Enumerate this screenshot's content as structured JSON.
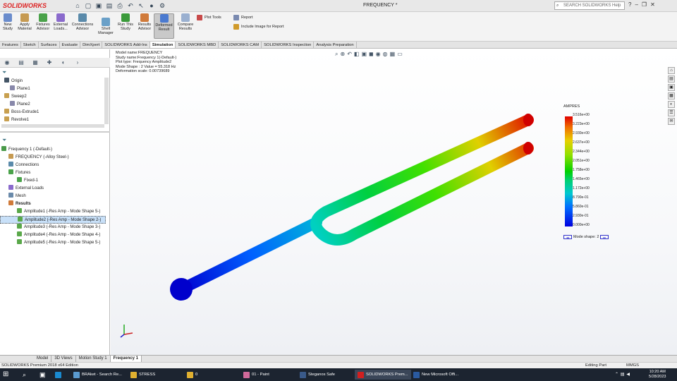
{
  "app": {
    "logo": "SOLIDWORKS",
    "window_title": "FREQUENCY *",
    "help_placeholder": "SEARCH SOLIDWORKS Help"
  },
  "ribbon": {
    "buttons": [
      {
        "label": "New\nStudy"
      },
      {
        "label": "Apply\nMaterial"
      },
      {
        "label": "Fixtures\nAdvisor"
      },
      {
        "label": "External\nLoads..."
      },
      {
        "label": "Connections\nAdvisor"
      },
      {
        "label": "Shell\nManager"
      },
      {
        "label": "Run This\nStudy"
      },
      {
        "label": "Results\nAdvisor"
      },
      {
        "label": "Deformed\nResult"
      },
      {
        "label": "Compare\nResults"
      }
    ],
    "plot_tools": "Plot Tools",
    "report": "Report",
    "include_image": "Include Image for Report"
  },
  "tabs": [
    "Features",
    "Sketch",
    "Surfaces",
    "Evaluate",
    "DimXpert",
    "SOLIDWORKS Add-Ins",
    "Simulation",
    "SOLIDWORKS MBD",
    "SOLIDWORKS CAM",
    "SOLIDWORKS Inspection",
    "Analysis Preparation"
  ],
  "feature_tree": [
    "Origin",
    "Plane1",
    "Sweep2",
    "Plane2",
    "Boss-Extrude1",
    "Revolve1"
  ],
  "sim_tree": {
    "study": "Frequency 1 (-Default-)",
    "items": [
      "FREQUENCY (-Alloy Steel-)",
      "Connections",
      "Fixtures",
      "Fixed-1",
      "External Loads",
      "Mesh",
      "Results"
    ],
    "results": [
      "Amplitude1 (-Res Amp - Mode Shape 5-)",
      "Amplitude2 (-Res Amp - Mode Shape 2-)",
      "Amplitude3 (-Res Amp - Mode Shape 3-)",
      "Amplitude4 (-Res Amp - Mode Shape 4-)",
      "Amplitude5 (-Res Amp - Mode Shape 5-)"
    ]
  },
  "plot_info": {
    "model": "Model name:FREQUENCY",
    "study": "Study name:Frequency 1(-Default-)",
    "plot_type": "Plot type: Frequency Amplitude2",
    "mode": "Mode Shape : 2  Value =    55.318 Hz",
    "scale": "Deformation scale: 0.00739689"
  },
  "legend": {
    "title": "AMPRES",
    "ticks": [
      "3.516e+00",
      "3.223e+00",
      "2.930e+00",
      "2.637e+00",
      "2.344e+00",
      "2.051e+00",
      "1.758e+00",
      "1.465e+00",
      "1.172e+00",
      "8.790e-01",
      "5.860e-01",
      "2.930e-01",
      "0.000e+00"
    ],
    "mode_shape": "Mode shape: 2"
  },
  "bottom_tabs": [
    "Model",
    "3D Views",
    "Motion Study 1",
    "Frequency 1"
  ],
  "status": {
    "left": "SOLIDWORKS Premium 2018 x64 Edition",
    "mode": "Editing Part",
    "units": "MMGS"
  },
  "taskbar": {
    "items": [
      "BRAket - Search Re...",
      "STRESS",
      "0",
      "01 - Paint",
      "Steganos Safe",
      "SOLIDWORKS Prem...",
      "New Microsoft Offi..."
    ],
    "time": "10:20 AM",
    "date": "5/28/2023"
  }
}
